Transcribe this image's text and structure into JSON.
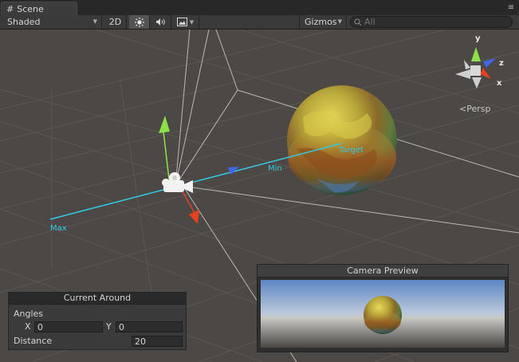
{
  "tab": {
    "title": "Scene"
  },
  "toolbar": {
    "shading_mode": "Shaded",
    "mode_2d": "2D",
    "gizmos_label": "Gizmos",
    "search_placeholder": "All"
  },
  "scene": {
    "handle_labels": {
      "max": "Max",
      "min": "Min",
      "target": "Target"
    },
    "axis_labels": {
      "y": "y",
      "z": "z",
      "x": "x"
    },
    "projection": "Persp",
    "colors": {
      "background": "#4c4845",
      "grid": "#615c57",
      "handle_line": "#33c9e6",
      "y_axis": "#8ee04a",
      "z_axis": "#3f68e8",
      "x_axis": "#e2421f"
    }
  },
  "current_around": {
    "title": "Current Around",
    "angles_label": "Angles",
    "x_label": "X",
    "x_value": "0",
    "y_label": "Y",
    "y_value": "0",
    "distance_label": "Distance",
    "distance_value": "20"
  },
  "camera_preview": {
    "title": "Camera Preview"
  },
  "icons": [
    "scene-tab-icon",
    "dropdown-arrow-icon",
    "sun-icon",
    "audio-icon",
    "image-effects-icon",
    "search-icon",
    "scene-gizmo-icon",
    "camera-icon",
    "tab-menu-icon"
  ]
}
